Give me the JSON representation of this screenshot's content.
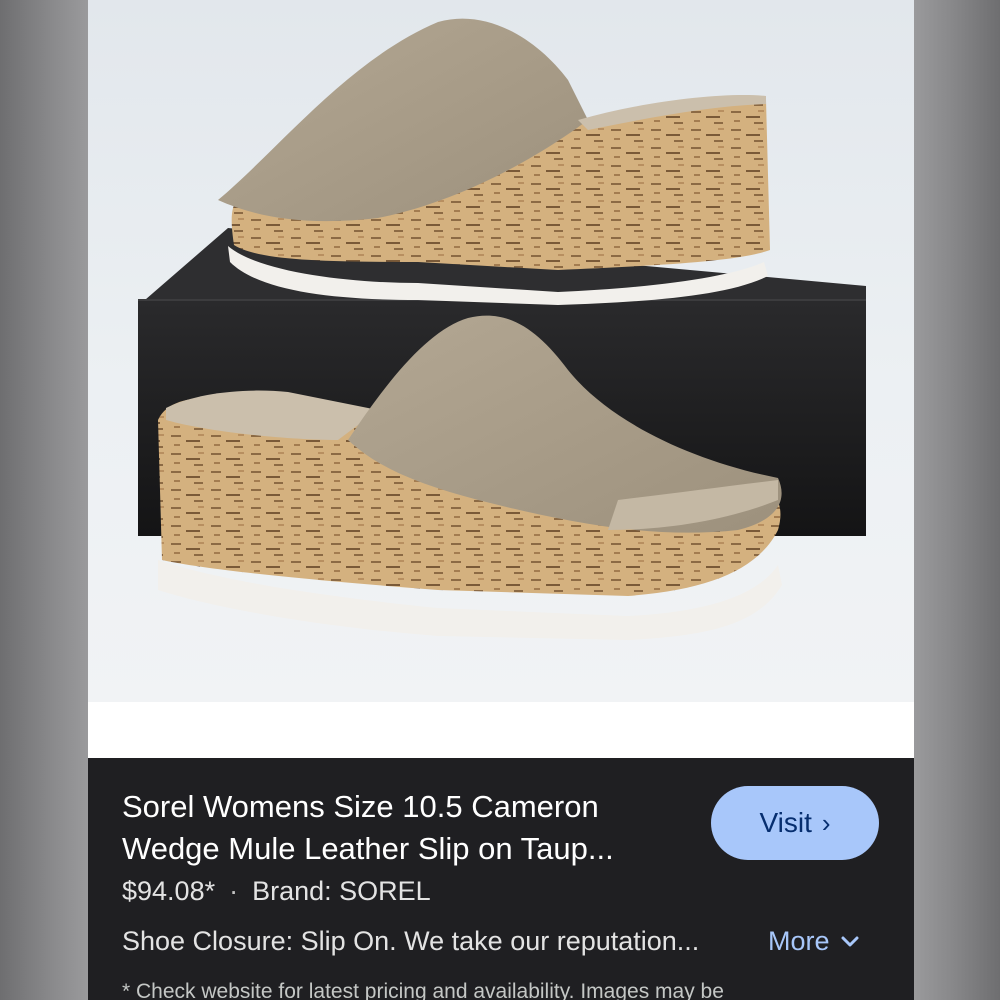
{
  "product": {
    "title": "Sorel Womens Size 10.5 Cameron Wedge Mule Leather Slip on Taup...",
    "price": "$94.08*",
    "separator": "·",
    "brand": "Brand: SOREL",
    "description": "Shoe Closure: Slip On. We take our reputation...",
    "more_label": "More",
    "disclaimer": "* Check website for latest pricing and availability. Images may be"
  },
  "actions": {
    "visit_label": "Visit",
    "visit_icon": "chevron-right-icon",
    "more_icon": "chevron-down-icon"
  },
  "colors": {
    "panel_bg": "#1f1f22",
    "visit_button_bg": "#a8c7fa",
    "link_color": "#a8c7fa",
    "upper_leather": "#a89c88",
    "cork": "#d2b07f",
    "outsole": "#f2f0ec",
    "box": "#1c1c1e"
  }
}
